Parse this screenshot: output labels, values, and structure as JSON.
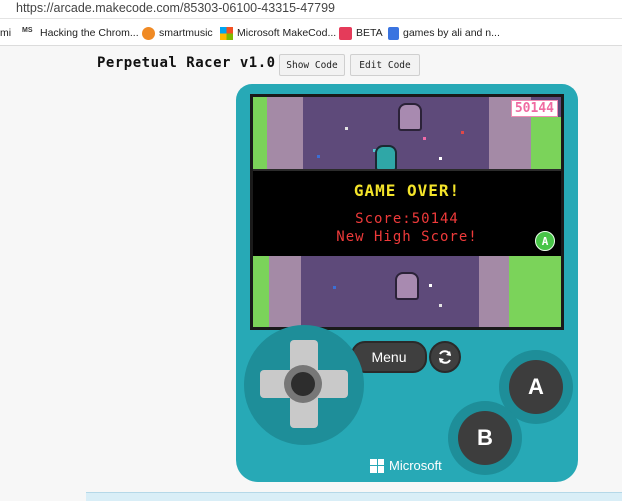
{
  "browser": {
    "url": "https://arcade.makecode.com/85303-06100-43315-47799",
    "bookmarks": [
      {
        "label": "mi",
        "icon": "none"
      },
      {
        "label": "Hacking the Chrom...",
        "icon": "ms-text-icon"
      },
      {
        "label": "smartmusic",
        "icon": "smartmusic-icon"
      },
      {
        "label": "Microsoft MakeCod...",
        "icon": "microsoft-logo-icon"
      },
      {
        "label": "BETA",
        "icon": "beta-icon"
      },
      {
        "label": "games by ali and n...",
        "icon": "docs-icon"
      }
    ]
  },
  "app": {
    "title": "Perpetual Racer v1.0",
    "show_code_label": "Show Code",
    "edit_code_label": "Edit Code"
  },
  "game": {
    "hud_score": "50144",
    "game_over": "GAME OVER!",
    "score_line": "Score:50144",
    "new_high_score": "New High Score!",
    "a_prompt": "A",
    "colors": {
      "track": "#5e4a7a",
      "grass": "#7bd35a",
      "banner": "#000000",
      "game_over_text": "#f4e42a",
      "score_text": "#ee3a3a"
    }
  },
  "controls": {
    "menu_label": "Menu",
    "a_label": "A",
    "b_label": "B",
    "brand": "Microsoft",
    "console_color": "#27a9b6"
  }
}
